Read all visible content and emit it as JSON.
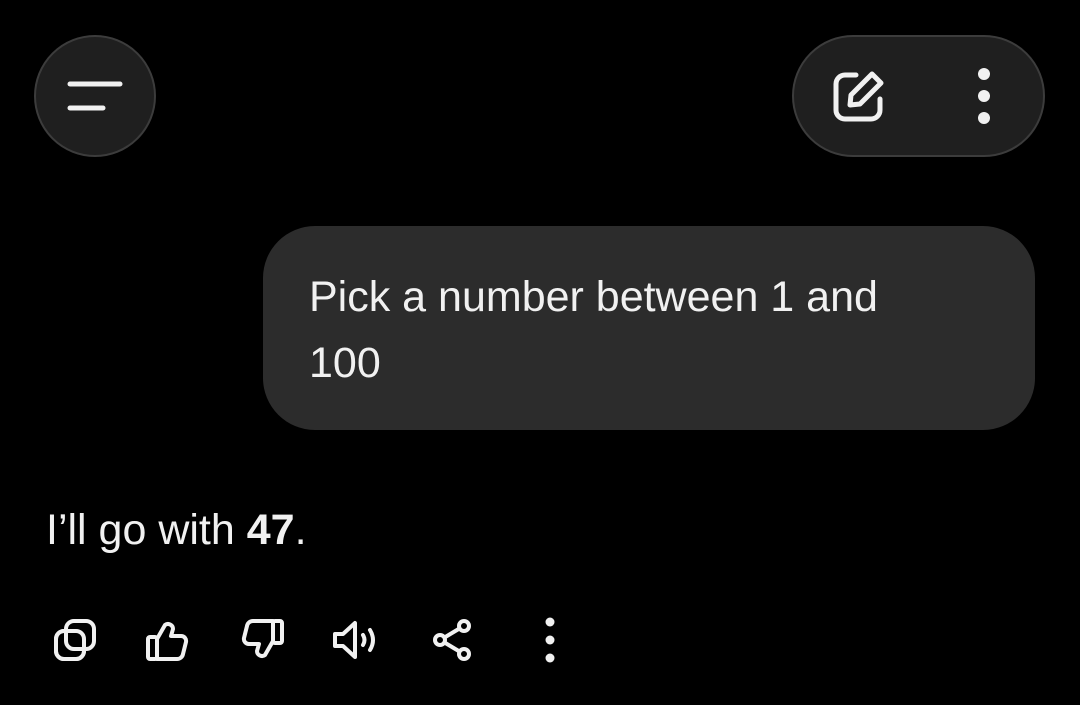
{
  "header": {
    "menu_icon": "menu-lines-icon",
    "edit_icon": "pencil-square-icon",
    "more_icon": "more-vertical-icon"
  },
  "conversation": {
    "user_message": "Pick a number between 1 and 100",
    "assistant_reply": {
      "prefix": "I’ll go with ",
      "number": "47",
      "suffix": "."
    }
  },
  "actions": [
    {
      "icon": "copy-icon"
    },
    {
      "icon": "thumbs-up-icon"
    },
    {
      "icon": "thumbs-down-icon"
    },
    {
      "icon": "speaker-icon"
    },
    {
      "icon": "share-icon"
    },
    {
      "icon": "more-vertical-icon"
    }
  ],
  "colors": {
    "background": "#000000",
    "button_fill": "#1f1f1f",
    "button_border": "#3c3c3c",
    "bubble": "#2c2c2c",
    "text": "#f1f1f1"
  }
}
